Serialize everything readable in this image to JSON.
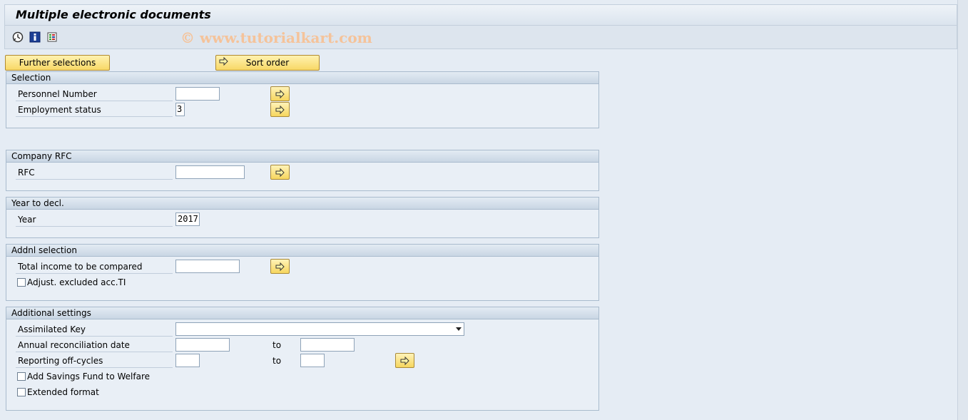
{
  "window": {
    "title": "Multiple electronic documents",
    "watermark": "© www.tutorialkart.com"
  },
  "toolbar": {
    "icons": [
      "execute-icon",
      "info-icon",
      "selection-screen-icon"
    ]
  },
  "buttons": {
    "further_selections": "Further selections",
    "sort_order": "Sort order"
  },
  "selection": {
    "title": "Selection",
    "personnel_number": {
      "label": "Personnel Number",
      "value": ""
    },
    "employment_status": {
      "label": "Employment status",
      "value": "3"
    }
  },
  "company_rfc": {
    "title": "Company RFC",
    "rfc": {
      "label": "RFC",
      "value": ""
    }
  },
  "year_to_decl": {
    "title": "Year to decl.",
    "year": {
      "label": "Year",
      "value": "2017"
    }
  },
  "addnl_selection": {
    "title": "Addnl selection",
    "total_income": {
      "label": "Total income to be compared",
      "value": ""
    },
    "adjust_excluded": {
      "label": "Adjust. excluded acc.TI",
      "checked": false
    }
  },
  "additional_settings": {
    "title": "Additional settings",
    "assimilated_key": {
      "label": "Assimilated Key",
      "value": ""
    },
    "annual_reconciliation": {
      "label": "Annual reconciliation date",
      "from": "",
      "to_label": "to",
      "to": ""
    },
    "reporting_offcycles": {
      "label": "Reporting off-cycles",
      "from": "",
      "to_label": "to",
      "to": ""
    },
    "savings_fund": {
      "label": "Add Savings Fund to Welfare",
      "checked": false
    },
    "extended_format": {
      "label": "Extended format",
      "checked": false
    }
  },
  "colors": {
    "button_yellow": "#f8d866",
    "group_header": "#c9d6e4",
    "background": "#e5ecf4",
    "watermark": "#f5c39a"
  }
}
